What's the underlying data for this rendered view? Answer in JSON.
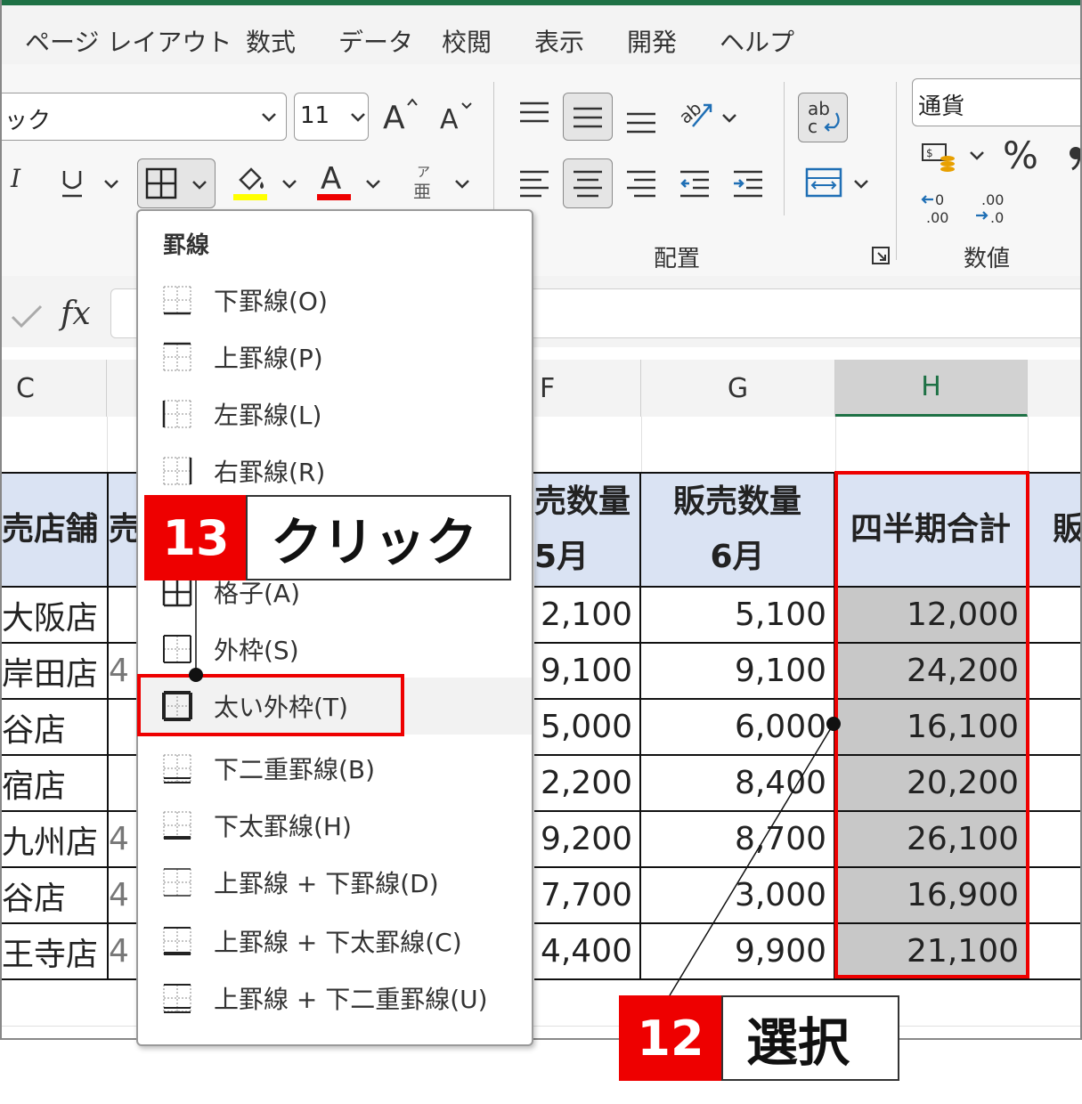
{
  "ribbon": {
    "tabs": [
      "ページ レイアウト",
      "数式",
      "データ",
      "校閲",
      "表示",
      "開発",
      "ヘルプ"
    ],
    "font_name": "ック",
    "font_size": "11",
    "number_format": "通貨",
    "group_alignment_label": "配置",
    "group_number_label": "数値",
    "percent_symbol": "%"
  },
  "formula_bar": {
    "fx_label": "fx"
  },
  "sheet": {
    "columns": [
      "C",
      "F",
      "G",
      "H"
    ],
    "headers": {
      "c": "売店舗",
      "d": "売",
      "f_line1": "売数量",
      "f_line2": "5月",
      "g_line1": "販売数量",
      "g_line2": "6月",
      "h": "四半期合計",
      "i": "販"
    },
    "rows": [
      {
        "store": "大阪店",
        "d": "",
        "f": "2,100",
        "g": "5,100",
        "h": "12,000"
      },
      {
        "store": "岸田店",
        "d": "4",
        "f": "9,100",
        "g": "9,100",
        "h": "24,200"
      },
      {
        "store": "谷店",
        "d": "",
        "f": "5,000",
        "g": "6,000",
        "h": "16,100"
      },
      {
        "store": "宿店",
        "d": "",
        "f": "2,200",
        "g": "8,400",
        "h": "20,200"
      },
      {
        "store": "九州店",
        "d": "4",
        "f": "9,200",
        "g": "8,700",
        "h": "26,100"
      },
      {
        "store": "谷店",
        "d": "4",
        "f": "7,700",
        "g": "3,000",
        "h": "16,900"
      },
      {
        "store": "王寺店",
        "d": "4",
        "f": "4,400",
        "g": "9,900",
        "h": "21,100"
      }
    ]
  },
  "border_menu": {
    "title": "罫線",
    "items": [
      {
        "label": "下罫線(O)",
        "icon": "border-bottom-icon"
      },
      {
        "label": "上罫線(P)",
        "icon": "border-top-icon"
      },
      {
        "label": "左罫線(L)",
        "icon": "border-left-icon"
      },
      {
        "label": "右罫線(R)",
        "icon": "border-right-icon"
      },
      {
        "label": "格子(A)",
        "icon": "border-all-icon"
      },
      {
        "label": "外枠(S)",
        "icon": "border-outside-icon"
      },
      {
        "label": "太い外枠(T)",
        "icon": "border-thick-outside-icon"
      },
      {
        "label": "下二重罫線(B)",
        "icon": "border-double-bottom-icon"
      },
      {
        "label": "下太罫線(H)",
        "icon": "border-thick-bottom-icon"
      },
      {
        "label": "上罫線 + 下罫線(D)",
        "icon": "border-top-bottom-icon"
      },
      {
        "label": "上罫線 + 下太罫線(C)",
        "icon": "border-top-thick-bottom-icon"
      },
      {
        "label": "上罫線 + 下二重罫線(U)",
        "icon": "border-top-double-bottom-icon"
      }
    ]
  },
  "callouts": {
    "step13_number": "13",
    "step13_text": "クリック",
    "step12_number": "12",
    "step12_text": "選択"
  },
  "colors": {
    "accent_red": "#ee0000",
    "excel_green": "#1e7145",
    "header_fill": "#dae3f3",
    "selection_fill": "#c8c8c8"
  }
}
